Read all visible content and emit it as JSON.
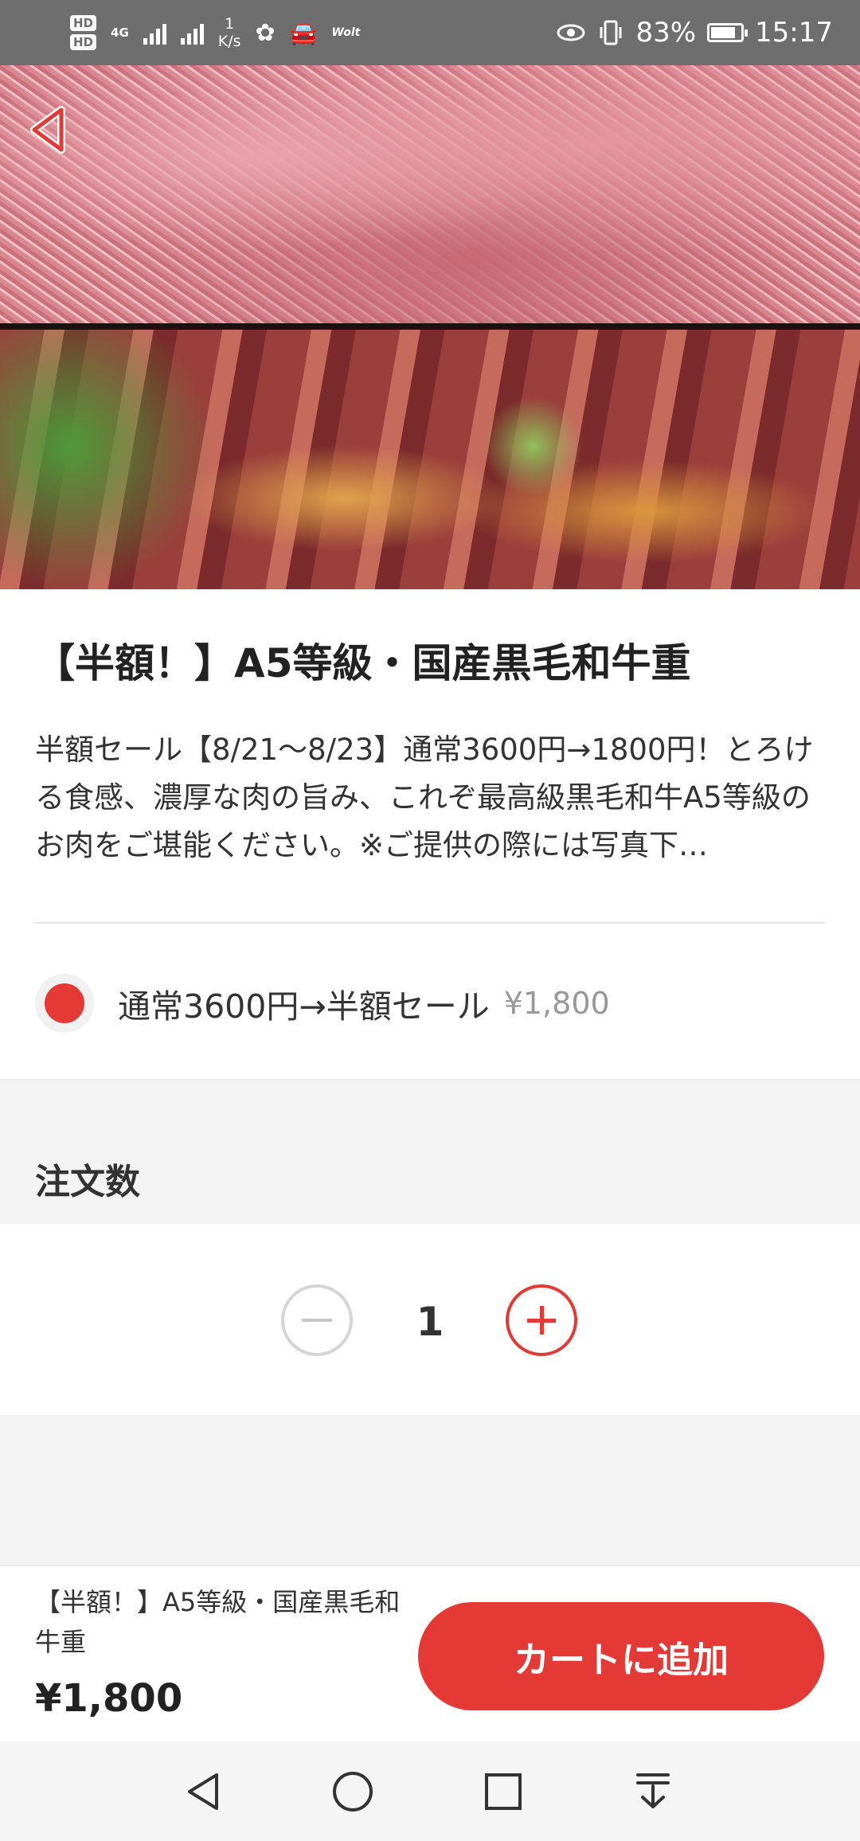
{
  "status_bar": {
    "network_label": "4G",
    "speed_value": "1",
    "speed_unit": "K/s",
    "app_tag": "Wolt",
    "battery": "83%",
    "battery_level": 0.83,
    "time": "15:17"
  },
  "product": {
    "title": "【半額！】A5等級・国産黒毛和牛重",
    "description": "半額セール【8/21〜8/23】通常3600円→1800円！とろける食感、濃厚な肉の旨み、これぞ最高級黒毛和牛A5等級のお肉をご堪能ください。※ご提供の際には写真下…"
  },
  "option": {
    "label": "通常3600円→半額セール",
    "price": "¥1,800",
    "selected": true
  },
  "quantity": {
    "heading": "注文数",
    "value": "1"
  },
  "bottom_bar": {
    "item_name": "【半額！】A5等級・国産黒毛和牛重",
    "price": "¥1,800",
    "add_to_cart_label": "カートに追加"
  },
  "colors": {
    "accent": "#e53935",
    "status_bar": "#6e6e6e",
    "band_gray": "#f3f3f3"
  },
  "icons": [
    "back-icon",
    "minus-icon",
    "plus-icon",
    "nav-back-icon",
    "nav-home-icon",
    "nav-recents-icon",
    "nav-dropdown-icon"
  ]
}
